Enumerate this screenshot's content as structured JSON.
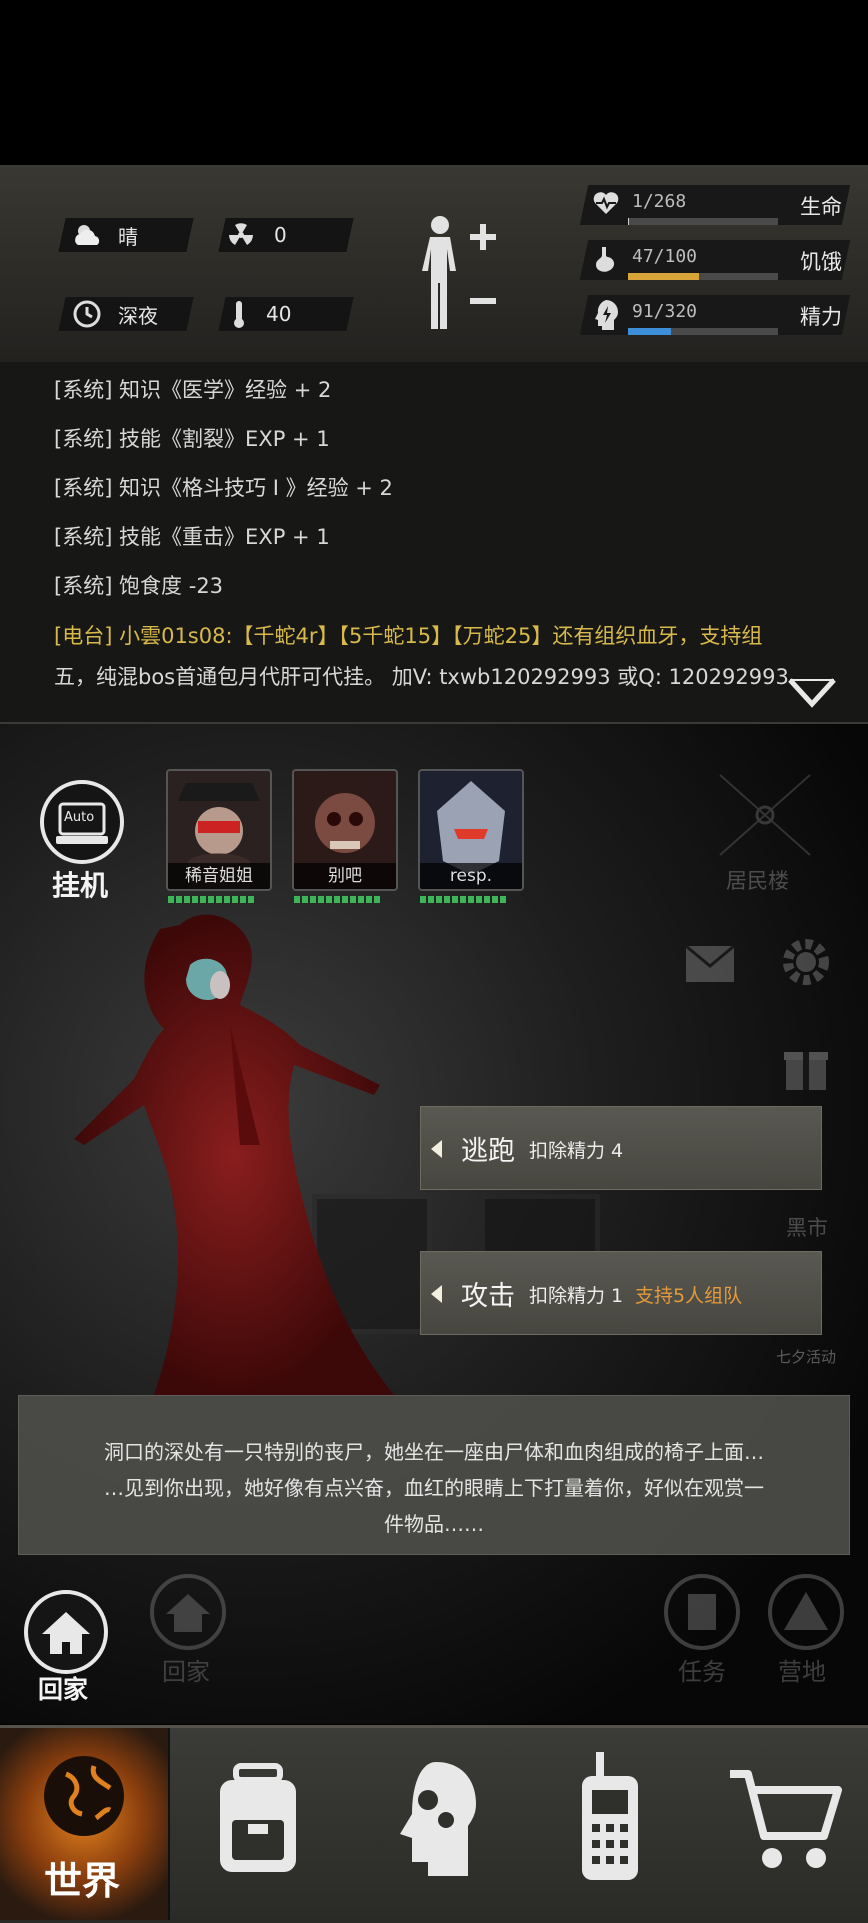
{
  "status": {
    "weather_label": "晴",
    "radiation_value": "0",
    "time_label": "深夜",
    "temperature_value": "40",
    "stats": [
      {
        "icon": "heart-pulse-icon",
        "value": "1/268",
        "label": "生命",
        "fraction": 0.004,
        "color": "#d0d0d0"
      },
      {
        "icon": "stomach-icon",
        "value": "47/100",
        "label": "饥饿",
        "fraction": 0.47,
        "color": "#d9a43a"
      },
      {
        "icon": "head-lightning-icon",
        "value": "91/320",
        "label": "精力",
        "fraction": 0.284,
        "color": "#3d8fd9"
      }
    ]
  },
  "log": {
    "lines": [
      "[系统] 知识《医学》经验 + 2",
      "[系统] 技能《割裂》EXP + 1",
      "[系统] 知识《格斗技巧 I 》经验 + 2",
      "[系统] 技能《重击》EXP + 1",
      "[系统] 饱食度 -23"
    ],
    "radio_prefix": "[电台]",
    "radio_line1": "小雲01s08:【千蛇4r】【5千蛇15】【万蛇25】还有组织血牙，支持组",
    "radio_line2": "五，纯混bos首通包月代肝可代挂。 加V: txwb120292993 或Q: 120292993"
  },
  "auto": {
    "icon_text": "Auto",
    "label": "挂机"
  },
  "party": [
    {
      "name": "稀音姐姐"
    },
    {
      "name": "别吧"
    },
    {
      "name": "resp."
    }
  ],
  "side": {
    "residence_label": "居民楼",
    "blackmarket_label": "黑市",
    "event_label": "七夕活动"
  },
  "actions": [
    {
      "label": "逃跑",
      "cost": "扣除精力 4",
      "extra": ""
    },
    {
      "label": "攻击",
      "cost": "扣除精力 1",
      "extra": "支持5人组队"
    }
  ],
  "description": {
    "line1": "洞口的深处有一只特别的丧尸，她坐在一座由尸体和血肉组成的椅子上面…",
    "line2": "…见到你出现，她好像有点兴奋，血红的眼睛上下打量着你，好似在观赏一",
    "line3": "件物品……"
  },
  "lower": {
    "home_label": "回家",
    "home_label_faded": "回家",
    "task_label": "任务",
    "camp_label": "营地"
  },
  "nav": {
    "world_label": "世界"
  },
  "colors": {
    "accent_orange": "#e59a3a",
    "hp_green": "#3fb55a"
  }
}
